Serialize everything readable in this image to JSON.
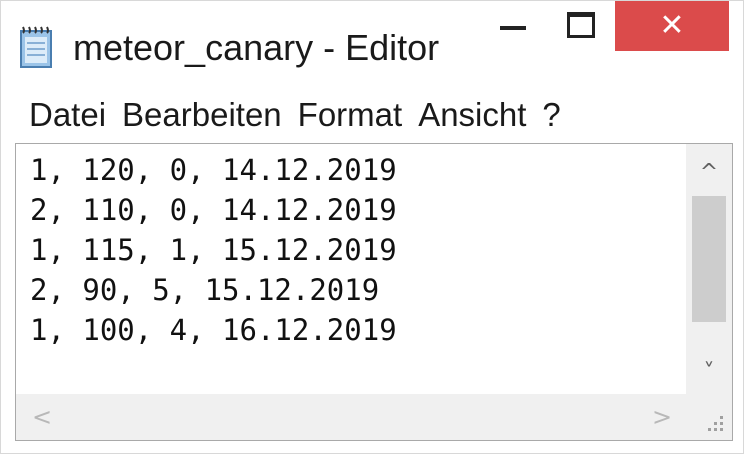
{
  "window": {
    "title": "meteor_canary - Editor",
    "app_icon": "notepad-icon",
    "minimize_icon": "minimize-icon",
    "maximize_icon": "maximize-icon",
    "close_icon": "close-icon",
    "close_glyph": "✕",
    "close_color": "#db4b4b"
  },
  "menu": {
    "items": [
      {
        "label": "Datei"
      },
      {
        "label": "Bearbeiten"
      },
      {
        "label": "Format"
      },
      {
        "label": "Ansicht"
      },
      {
        "label": "?"
      }
    ]
  },
  "editor": {
    "lines": [
      "1, 120, 0, 14.12.2019",
      "2, 110, 0, 14.12.2019",
      "1, 115, 1, 15.12.2019",
      "2, 90, 5, 15.12.2019",
      "1, 100, 4, 16.12.2019"
    ]
  },
  "scrollbars": {
    "up_glyph": "^",
    "down_glyph": "˅",
    "left_glyph": "<",
    "right_glyph": ">"
  }
}
